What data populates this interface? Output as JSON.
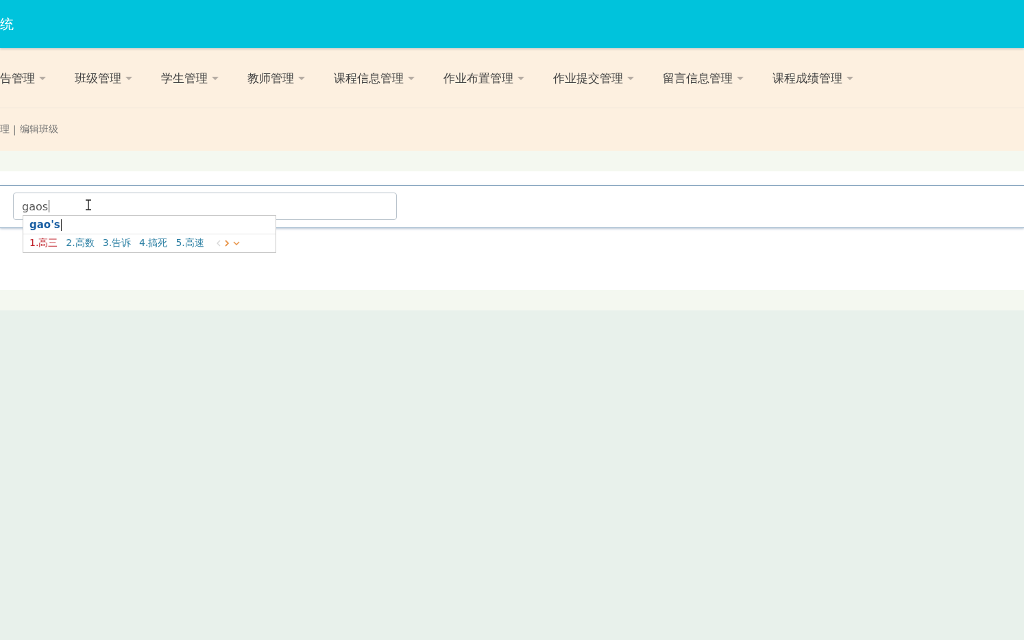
{
  "header": {
    "title": "统"
  },
  "nav": {
    "items": [
      {
        "label": "告管理"
      },
      {
        "label": "班级管理"
      },
      {
        "label": "学生管理"
      },
      {
        "label": "教师管理"
      },
      {
        "label": "课程信息管理"
      },
      {
        "label": "作业布置管理"
      },
      {
        "label": "作业提交管理"
      },
      {
        "label": "留言信息管理"
      },
      {
        "label": "课程成绩管理"
      }
    ]
  },
  "breadcrumb": {
    "items": [
      {
        "label": "理"
      },
      {
        "label": "编辑班级"
      }
    ],
    "separator": "|"
  },
  "form": {
    "field": {
      "value": "gaos"
    }
  },
  "ime": {
    "composition": "gao's",
    "candidates": [
      {
        "label": "1.高三",
        "selected": true
      },
      {
        "label": "2.高数",
        "selected": false
      },
      {
        "label": "3.告诉",
        "selected": false
      },
      {
        "label": "4.搞死",
        "selected": false
      },
      {
        "label": "5.高速",
        "selected": false
      }
    ],
    "prev_enabled": false,
    "next_enabled": true
  }
}
